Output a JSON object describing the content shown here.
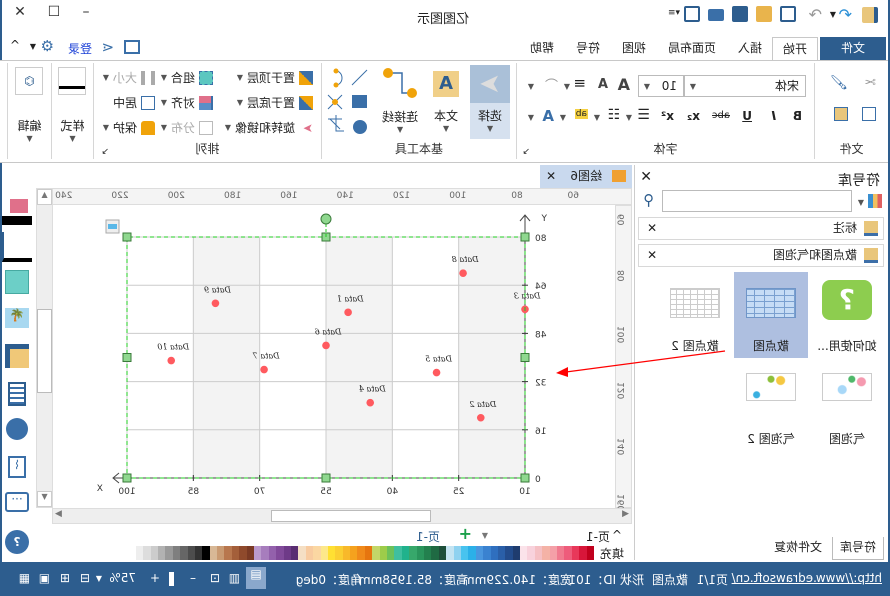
{
  "app": {
    "title": "亿图图示"
  },
  "window": {
    "minimize": "–",
    "maximize": "☐",
    "close": "✕"
  },
  "account": {
    "login": "登录"
  },
  "tabs": [
    {
      "label": "文件"
    },
    {
      "label": "开始"
    },
    {
      "label": "插入"
    },
    {
      "label": "页面布局"
    },
    {
      "label": "视图"
    },
    {
      "label": "符号"
    },
    {
      "label": "帮助"
    }
  ],
  "ribbon": {
    "file_group": "文件",
    "font_group": "字体",
    "font_name": "宋体",
    "font_size": "10",
    "bold": "B",
    "italic": "I",
    "underline": "U",
    "strike": "abc",
    "subscript": "x₂",
    "superscript": "x²",
    "font_color": "A",
    "grow": "A",
    "shrink": "A",
    "tools_group": "基本工具",
    "select": "选择",
    "text": "文本",
    "connector": "连接线",
    "arrange_group": "排列",
    "bring_front": "置于顶层",
    "send_back": "置于底层",
    "rotate": "旋转和镜像",
    "group": "组合",
    "align": "对齐",
    "distribute": "分布",
    "size": "大小",
    "center": "居中",
    "protect": "保护",
    "style": "样式",
    "edit": "编辑"
  },
  "library": {
    "title": "符号库",
    "search_placeholder": "",
    "sections": [
      {
        "label": "标注"
      },
      {
        "label": "散点图和气泡图"
      }
    ],
    "thumbs": [
      {
        "label": "如何使用..."
      },
      {
        "label": "散点图"
      },
      {
        "label": "散点图 2"
      },
      {
        "label": "气泡图"
      },
      {
        "label": "气泡图 2"
      }
    ],
    "bottom_tabs": [
      {
        "label": "符号库"
      },
      {
        "label": "文件恢复"
      }
    ]
  },
  "document": {
    "tab": "绘图6"
  },
  "rulers": {
    "h": [
      "60",
      "80",
      "100",
      "120",
      "140",
      "160",
      "180",
      "200",
      "220",
      "240"
    ],
    "v": [
      "60",
      "80",
      "100",
      "120",
      "140",
      "160"
    ]
  },
  "pages": {
    "current": "页-1",
    "tab": "页-1",
    "add": "+"
  },
  "palette": {
    "label": "填充",
    "colors": [
      "#c0001d",
      "#d8163a",
      "#e8385a",
      "#ee5c7b",
      "#f07a8f",
      "#f4a0a8",
      "#f4b2a6",
      "#f5c0c4",
      "#f8d2dc",
      "#fbe3ea",
      "#1f3c6e",
      "#234c8c",
      "#2a5fa8",
      "#2f6fbf",
      "#3a82d0",
      "#4a96de",
      "#2bb0e8",
      "#48c3ef",
      "#8fd2f0",
      "#c4e4f2",
      "#1e4f3a",
      "#1f6a43",
      "#23804e",
      "#2a955c",
      "#37a86b",
      "#20b28c",
      "#3fbf9f",
      "#6cc15a",
      "#9dcc4a",
      "#c3d768",
      "#e6750f",
      "#f08a1a",
      "#f5a21e",
      "#f8b92a",
      "#fbcf32",
      "#ffe033",
      "#fde88a",
      "#fbd7a2",
      "#f8cba0",
      "#f5dfc4",
      "#5a2d72",
      "#6e3a88",
      "#814a9a",
      "#9361ac",
      "#a77dbd",
      "#bb9acd",
      "#7a3a24",
      "#8f4a2c",
      "#a45f3a",
      "#b8774e",
      "#c99a72",
      "#d8b896",
      "#000000",
      "#333333",
      "#4d4d4d",
      "#666666",
      "#7f7f7f",
      "#999999",
      "#b2b2b2",
      "#cccccc",
      "#dddddd",
      "#eeeeee"
    ]
  },
  "status": {
    "url": "http://www.edrawsoft.cn/",
    "page": "页1/1",
    "shape": "散点图",
    "shape_id": "形状 ID：101",
    "width": "宽度：140.229mm",
    "height": "高度：85.1958mm",
    "angle": "角度：0deg",
    "zoom": "75%"
  },
  "chart_data": {
    "type": "scatter",
    "xlabel": "X",
    "ylabel": "Y",
    "xlim": [
      10,
      100
    ],
    "ylim": [
      0,
      80
    ],
    "xticks": [
      10,
      25,
      40,
      55,
      70,
      85,
      100
    ],
    "yticks": [
      0,
      16,
      32,
      48,
      64,
      80
    ],
    "grid": true,
    "color": "#ff5a5f",
    "points": [
      {
        "label": "Data 1",
        "x": 50,
        "y": 55
      },
      {
        "label": "Data 2",
        "x": 20,
        "y": 20
      },
      {
        "label": "Data 3",
        "x": 10,
        "y": 56
      },
      {
        "label": "Data 4",
        "x": 45,
        "y": 25
      },
      {
        "label": "Data 5",
        "x": 30,
        "y": 35
      },
      {
        "label": "Data 6",
        "x": 55,
        "y": 44
      },
      {
        "label": "Data 7",
        "x": 69,
        "y": 36
      },
      {
        "label": "Data 8",
        "x": 24,
        "y": 68
      },
      {
        "label": "Data 9",
        "x": 80,
        "y": 58
      },
      {
        "label": "Data 10",
        "x": 90,
        "y": 39
      }
    ]
  }
}
